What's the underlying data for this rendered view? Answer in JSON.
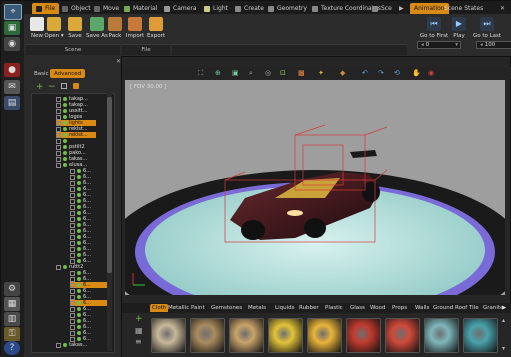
{
  "menu_tabs": [
    {
      "label": "File",
      "active": true
    },
    {
      "label": "Object"
    },
    {
      "label": "Move"
    },
    {
      "label": "Material"
    },
    {
      "label": "Camera"
    },
    {
      "label": "Light"
    },
    {
      "label": "Create"
    },
    {
      "label": "Geometry"
    },
    {
      "label": "Texture Coordinates"
    },
    {
      "label": "Sce"
    }
  ],
  "menu_right_tabs": [
    {
      "label": "Animation",
      "active": true
    },
    {
      "label": "Scene States"
    }
  ],
  "ribbon": {
    "scene_buttons": [
      "New",
      "Open",
      "Save",
      "Save As",
      "Pack"
    ],
    "file_buttons": [
      "Import",
      "Export"
    ],
    "scene_group": "Scene",
    "file_group": "File",
    "open_arrow": "▾",
    "anim_buttons": [
      "Go to First",
      "Play",
      "Go to Last"
    ],
    "start_frame": "0",
    "end_frame": "100"
  },
  "left_panel": {
    "tabs": [
      "Basic",
      "Advanced"
    ],
    "active_tab": "Advanced",
    "tree": [
      {
        "label": "takap...",
        "sel": false
      },
      {
        "label": "takap...",
        "sel": false
      },
      {
        "label": "ussitt...",
        "sel": false
      },
      {
        "label": "logos",
        "sel": false
      },
      {
        "label": "lights",
        "sel": true
      },
      {
        "label": "reklst...",
        "sel": false
      },
      {
        "label": "reklst...",
        "sel": true
      },
      {
        "label": "",
        "sel": false
      },
      {
        "label": "pstilt2",
        "sel": false
      },
      {
        "label": "pako...",
        "sel": false
      },
      {
        "label": "takas...",
        "sel": false
      },
      {
        "label": "elusa...",
        "sel": false
      },
      {
        "label": "6...",
        "sel": false
      },
      {
        "label": "6...",
        "sel": false
      },
      {
        "label": "6...",
        "sel": false
      },
      {
        "label": "6...",
        "sel": false
      },
      {
        "label": "6...",
        "sel": false
      },
      {
        "label": "6...",
        "sel": false
      },
      {
        "label": "6...",
        "sel": false
      },
      {
        "label": "6...",
        "sel": false
      },
      {
        "label": "6...",
        "sel": false
      },
      {
        "label": "6...",
        "sel": false
      },
      {
        "label": "6...",
        "sel": false
      },
      {
        "label": "6...",
        "sel": false
      },
      {
        "label": "6...",
        "sel": false
      },
      {
        "label": "6...",
        "sel": false
      },
      {
        "label": "6...",
        "sel": false
      },
      {
        "label": "6...",
        "sel": false
      },
      {
        "label": "ruttt2",
        "sel": false
      },
      {
        "label": "6...",
        "sel": false
      },
      {
        "label": "6...",
        "sel": false
      },
      {
        "label": "6...",
        "sel": true
      },
      {
        "label": "6...",
        "sel": false
      },
      {
        "label": "6...",
        "sel": false
      },
      {
        "label": "6...",
        "sel": true
      },
      {
        "label": "6...",
        "sel": false
      },
      {
        "label": "6...",
        "sel": false
      },
      {
        "label": "6...",
        "sel": false
      },
      {
        "label": "6...",
        "sel": false
      },
      {
        "label": "6...",
        "sel": false
      },
      {
        "label": "6...",
        "sel": false
      },
      {
        "label": "takas...",
        "sel": false
      }
    ]
  },
  "viewport": {
    "fov_label": "[ FOV 30.00 ]"
  },
  "library": {
    "tabs": [
      "Cloth",
      "Metallic Paint",
      "Gemstones",
      "Metals",
      "Liquids",
      "Rubber",
      "Plastic",
      "Glass",
      "Wood",
      "Props",
      "Walls",
      "Ground",
      "Roof Tile",
      "Granite"
    ],
    "active_tab": "Cloth",
    "swatch_colors": [
      "#c8b89a",
      "#a98b5e",
      "#c9a36a",
      "#e2c33a",
      "#e9b43a",
      "#c23a2e",
      "#d14a3a",
      "#7fb7bb",
      "#4aa2ac"
    ]
  },
  "colors": {
    "accent": "#d98a14",
    "tree_dot": "#6fbf4a",
    "viewport_bg": "#9e9e9e"
  }
}
